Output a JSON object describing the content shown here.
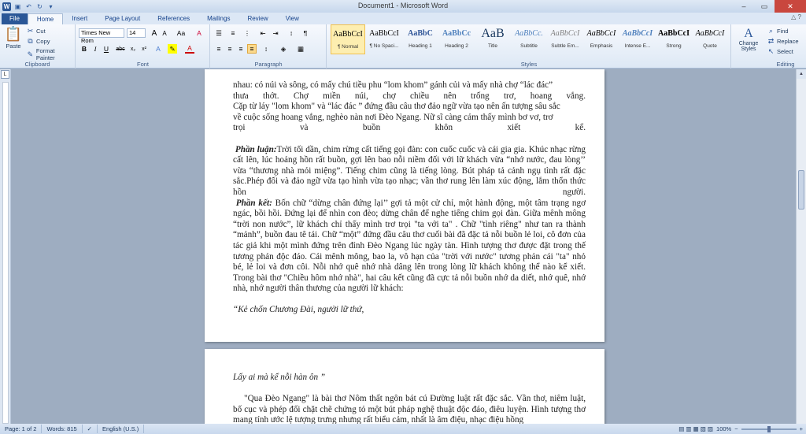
{
  "window": {
    "title": "Document1 - Microsoft Word",
    "controls": [
      "–",
      "▭",
      "✕"
    ]
  },
  "tabs": [
    "File",
    "Home",
    "Insert",
    "Page Layout",
    "References",
    "Mailings",
    "Review",
    "View"
  ],
  "ribbon": {
    "clipboard": {
      "label": "Clipboard",
      "paste": "Paste",
      "cut": "Cut",
      "copy": "Copy",
      "format_painter": "Format Painter"
    },
    "font": {
      "label": "Font",
      "font_name": "Times New Rom",
      "font_size": "14",
      "grow": "A",
      "shrink": "A",
      "case": "Aa",
      "clear": "A"
    },
    "paragraph": {
      "label": "Paragraph"
    },
    "styles": {
      "label": "Styles",
      "items": [
        {
          "preview": "AaBbCcI",
          "name": "¶ Normal"
        },
        {
          "preview": "AaBbCcI",
          "name": "¶ No Spaci..."
        },
        {
          "preview": "AaBbC",
          "name": "Heading 1"
        },
        {
          "preview": "AaBbCc",
          "name": "Heading 2"
        },
        {
          "preview": "AaB",
          "name": "Title"
        },
        {
          "preview": "AaBbCc.",
          "name": "Subtitle"
        },
        {
          "preview": "AaBbCcI",
          "name": "Subtle Em..."
        },
        {
          "preview": "AaBbCcI",
          "name": "Emphasis"
        },
        {
          "preview": "AaBbCcI",
          "name": "Intense E..."
        },
        {
          "preview": "AaBbCcI",
          "name": "Strong"
        },
        {
          "preview": "AaBbCcI",
          "name": "Quote"
        }
      ],
      "change_styles": "Change Styles"
    },
    "editing": {
      "label": "Editing",
      "find": "Find",
      "replace": "Replace",
      "select": "Select"
    }
  },
  "document": {
    "page1": {
      "para1_lines": [
        "nhau: có núi và sông, có mấy chú tiều phu “lom khom” gánh củi và mấy nhà chợ “lác đác”",
        "thưa thớt. Chợ miền núi, chợ chiều nên trống trơ, hoang vắng.",
        "Cặp từ láy \"lom khom\" và “lác đác ” đứng đầu câu thơ đảo ngữ vừa tạo nên ấn tượng sâu sắc",
        "về cuộc sống hoang vắng, nghèo nàn nơi Đèo Ngang. Nữ sĩ càng cảm thấy mình bơ vơ, trơ",
        "trọi và buồn khôn xiết kể."
      ],
      "body_label": "Phần luận:",
      "body_text": "Trời tối dần, chim rừng cất tiếng gọi đàn: con cuốc cuốc và cái gia gia. Khúc nhạc rừng cất lên, lúc hoảng hồn rất buồn, gợi lên bao nỗi niềm đối với lữ khách vừa “nhớ nước, đau lòng’’ vừa “thương nhà mỏi miệng”. Tiếng chim cũng là tiếng lòng. Bút pháp tả cảnh ngụ tình rất đặc sắc.Phép đối và đảo ngữ vừa tạo hình vừa tạo nhạc; vần thơ rung lên làm xúc động, lắm thổn thức hồn người.",
      "end_label": "Phần kết:",
      "end_text": "Bốn chữ “dừng chân đứng lại’’ gợi tả một cử chỉ, một hành động, một tâm trạng ngơ ngác, bồi hồi. Đứng lại để nhìn con đèo; dừng chân để nghe tiếng chim gọi đàn. Giữa mênh mông “trời non nước”, lữ khách chỉ thấy mình trơ trọi \"ta với ta\" . Chữ \"tình riêng\" như tan ra thành “mảnh”, buồn đau tê tái. Chữ “một” đứng đầu câu thơ cuối bài đã đặc tả nỗi buồn lẻ loi, cô đơn của tác giả khi một mình đứng trên đỉnh Đèo Ngang lúc ngày tàn. Hình tượng thơ được đặt trong thế tương phản độc đáo. Cái mênh mông, bao la, vô hạn của \"trời với nước\" tương phản cái \"ta\" nhỏ bé, lẻ loi và đơn côi. Nỗi nhớ quê nhớ nhà dâng lên trong lòng lữ khách không thể nào kể xiết. Trong bài thơ \"Chiều hôm nhớ nhà\", hai câu kết cũng đã cực tả nỗi buồn nhớ da diết, nhớ quê, nhớ nhà, nhớ người thân thương của người lữ khách:",
      "quote": "“Kẻ chốn Chương Đài, người lữ thứ,"
    },
    "page2": {
      "quote": "Lấy ai mà kể nỗi hàn ôn ”",
      "para": "\"Qua Đèo Ngang\" là bài thơ Nôm thất ngôn bát cú Đường luật rất đặc sắc. Vần thơ, niêm luật, bố cục và phép đối chặt chẽ chứng tỏ một bút pháp nghệ thuật độc đáo, điêu luyện. Hình tượng thơ mang tính ước lệ tượng trưng nhưng rất biểu cảm, nhất là âm điệu, nhạc điệu hồng"
    }
  },
  "status": {
    "page": "Page: 1 of 2",
    "words": "Words: 815",
    "language": "English (U.S.)",
    "zoom": "100%"
  }
}
